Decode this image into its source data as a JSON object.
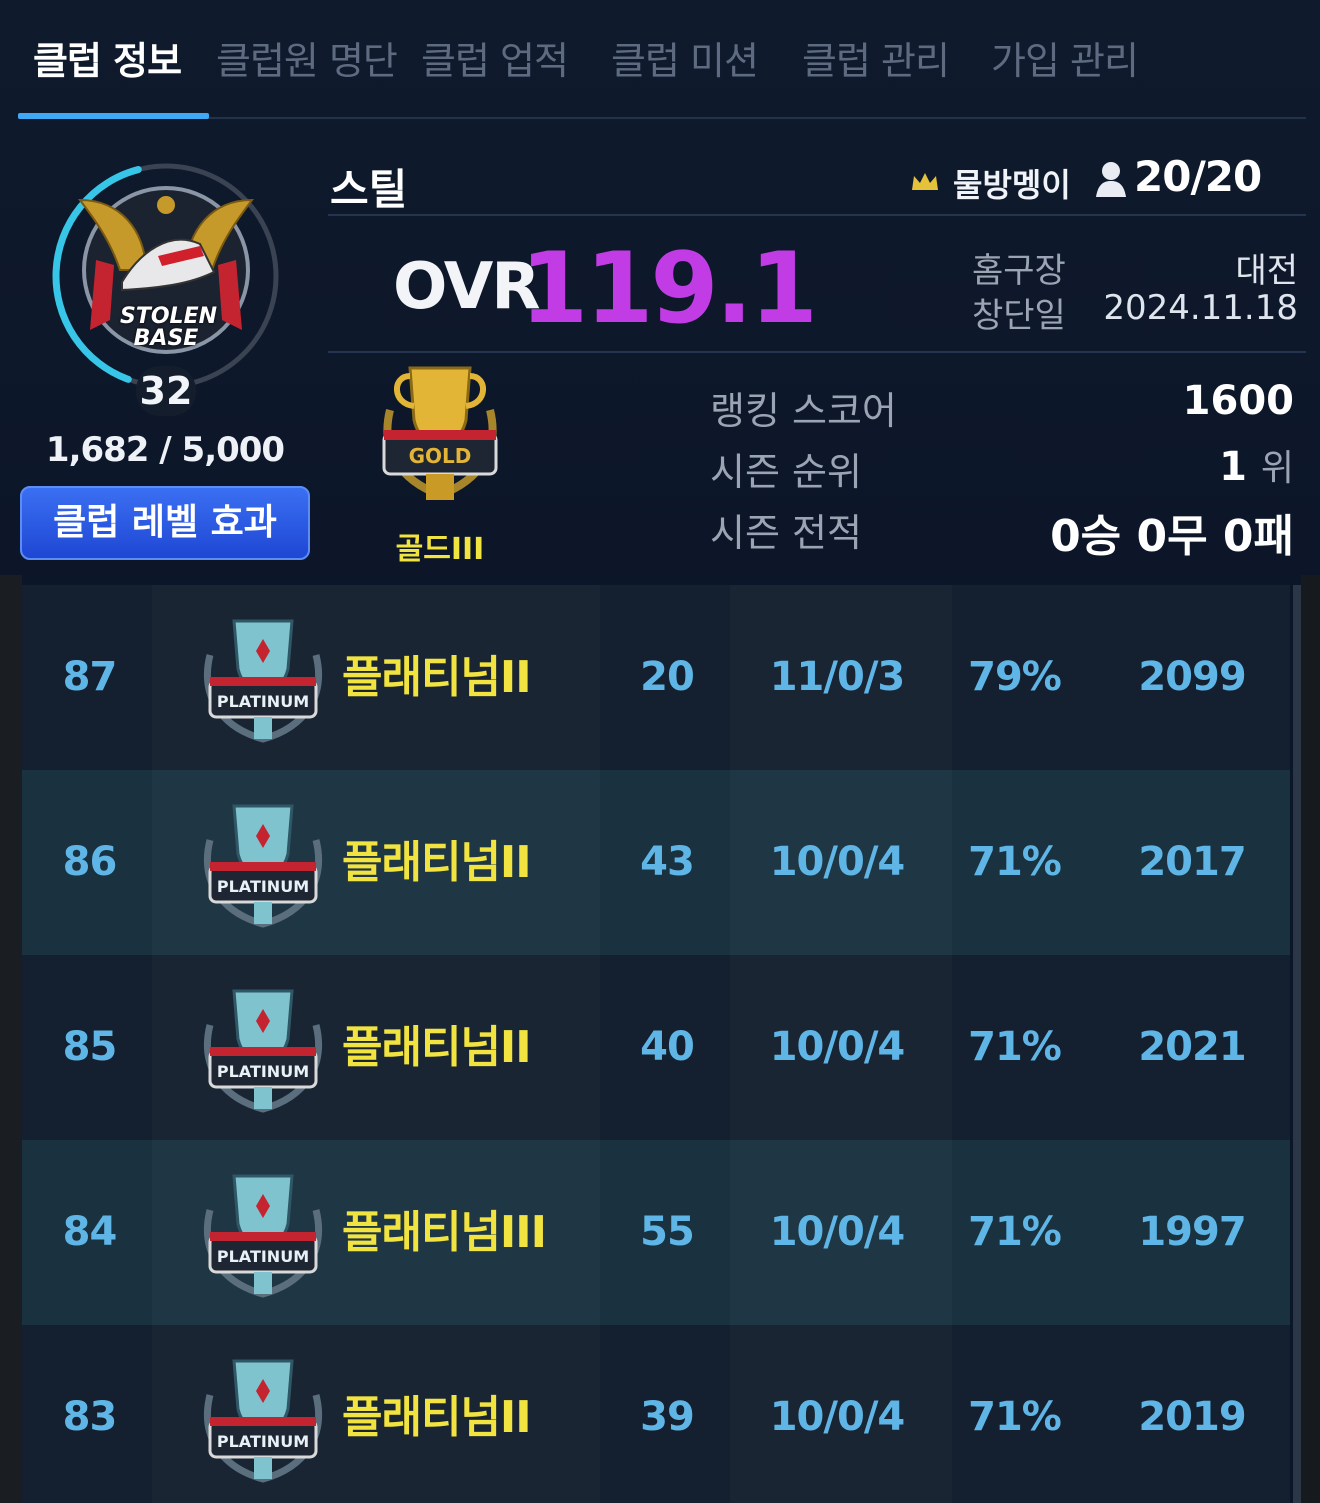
{
  "tabs": [
    {
      "label": "클럽 정보",
      "active": true
    },
    {
      "label": "클럽원 명단"
    },
    {
      "label": "클럽 업적"
    },
    {
      "label": "클럽 미션"
    },
    {
      "label": "클럽 관리"
    },
    {
      "label": "가입 관리"
    }
  ],
  "club": {
    "emblem_text_1": "STOLEN",
    "emblem_text_2": "BASE",
    "level": "32",
    "exp": "1,682 / 5,000",
    "exp_fraction": 0.3364,
    "level_button": "클럽 레벨 효과",
    "name": "스틸",
    "master_icon": "crown-icon",
    "master": "물방멩이",
    "members_icon": "person-icon",
    "members": "20/20",
    "ovr_label": "OVR",
    "ovr": "119.1",
    "home_label": "홈구장",
    "home_value": "대전",
    "founded_label": "창단일",
    "founded_value": "2024.11.18"
  },
  "tier": {
    "badge_text": "GOLD",
    "name": "골드III",
    "ranking_label": "랭킹 스코어",
    "ranking_value": "1600",
    "season_rank_label": "시즌 순위",
    "season_rank_value": "1",
    "season_rank_unit": "위",
    "season_record_label": "시즌 전적",
    "season_record_value": "0승 0무 0패"
  },
  "rows": [
    {
      "no": "87",
      "badge": "PLATINUM",
      "tier": "플래티넘II",
      "members": "20",
      "record": "11/0/3",
      "rate": "79%",
      "score": "2099"
    },
    {
      "no": "86",
      "badge": "PLATINUM",
      "tier": "플래티넘II",
      "members": "43",
      "record": "10/0/4",
      "rate": "71%",
      "score": "2017"
    },
    {
      "no": "85",
      "badge": "PLATINUM",
      "tier": "플래티넘II",
      "members": "40",
      "record": "10/0/4",
      "rate": "71%",
      "score": "2021"
    },
    {
      "no": "84",
      "badge": "PLATINUM",
      "tier": "플래티넘III",
      "members": "55",
      "record": "10/0/4",
      "rate": "71%",
      "score": "1997"
    },
    {
      "no": "83",
      "badge": "PLATINUM",
      "tier": "플래티넘II",
      "members": "39",
      "record": "10/0/4",
      "rate": "71%",
      "score": "2019"
    }
  ],
  "colors": {
    "accent": "#3fa9f5",
    "ovr": "#c23ce6",
    "tier_text": "#f2e440",
    "table_text": "#5fb6e6"
  }
}
